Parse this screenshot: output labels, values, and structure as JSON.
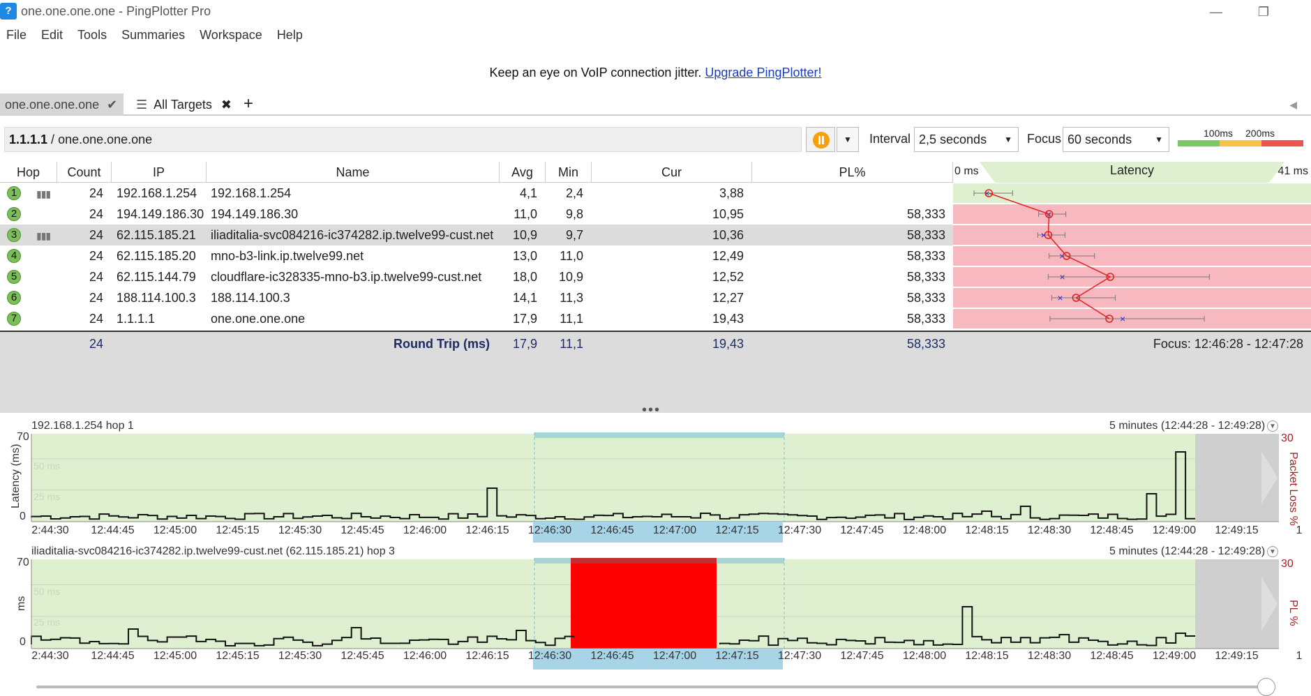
{
  "window": {
    "title": "one.one.one.one - PingPlotter Pro",
    "app_icon": "pingplotter-logo-icon",
    "minimize_icon": "—",
    "restore_icon": "❐"
  },
  "menu": [
    "File",
    "Edit",
    "Tools",
    "Summaries",
    "Workspace",
    "Help"
  ],
  "banner": {
    "text": "Keep an eye on VoIP connection jitter.",
    "link": "Upgrade PingPlotter!"
  },
  "tabs": {
    "active_label": "one.one.one.one",
    "all_targets_label": "All Targets",
    "add_label": "+"
  },
  "target": {
    "ip": "1.1.1.1",
    "separator": " / ",
    "host": "one.one.one.one"
  },
  "controls": {
    "interval_label": "Interval",
    "interval_value": "2,5 seconds",
    "focus_label": "Focus",
    "focus_value": "60 seconds",
    "scale_100": "100ms",
    "scale_200": "200ms"
  },
  "table": {
    "headers": [
      "Hop",
      "Count",
      "IP",
      "Name",
      "Avg",
      "Min",
      "Cur",
      "PL%"
    ],
    "latency_header": "Latency",
    "latency_min": "0 ms",
    "latency_max": "41 ms",
    "rows": [
      {
        "hop": "1",
        "count": "24",
        "ip": "192.168.1.254",
        "name": "192.168.1.254",
        "avg": "4,1",
        "min": "2,4",
        "cur": "3,88",
        "pl": ""
      },
      {
        "hop": "2",
        "count": "24",
        "ip": "194.149.186.30",
        "name": "194.149.186.30",
        "avg": "11,0",
        "min": "9,8",
        "cur": "10,95",
        "pl": "58,333"
      },
      {
        "hop": "3",
        "count": "24",
        "ip": "62.115.185.21",
        "name": "iliaditalia-svc084216-ic374282.ip.twelve99-cust.net",
        "avg": "10,9",
        "min": "9,7",
        "cur": "10,36",
        "pl": "58,333"
      },
      {
        "hop": "4",
        "count": "24",
        "ip": "62.115.185.20",
        "name": "mno-b3-link.ip.twelve99.net",
        "avg": "13,0",
        "min": "11,0",
        "cur": "12,49",
        "pl": "58,333"
      },
      {
        "hop": "5",
        "count": "24",
        "ip": "62.115.144.79",
        "name": "cloudflare-ic328335-mno-b3.ip.twelve99-cust.net",
        "avg": "18,0",
        "min": "10,9",
        "cur": "12,52",
        "pl": "58,333"
      },
      {
        "hop": "6",
        "count": "24",
        "ip": "188.114.100.3",
        "name": "188.114.100.3",
        "avg": "14,1",
        "min": "11,3",
        "cur": "12,27",
        "pl": "58,333"
      },
      {
        "hop": "7",
        "count": "24",
        "ip": "1.1.1.1",
        "name": "one.one.one.one",
        "avg": "17,9",
        "min": "11,1",
        "cur": "19,43",
        "pl": "58,333"
      }
    ],
    "summary": {
      "count": "24",
      "label": "Round Trip (ms)",
      "avg": "17,9",
      "min": "11,1",
      "cur": "19,43",
      "pl": "58,333",
      "focus": "Focus: 12:46:28 - 12:47:28"
    }
  },
  "graph1": {
    "title": "192.168.1.254 hop 1",
    "range": "5 minutes (12:44:28 - 12:49:28)",
    "y_label": "Latency (ms)",
    "y_top": "70",
    "y_zero": "0",
    "y_right_label": "Packet Loss %",
    "y_right_top": "30",
    "grid_50": "50 ms",
    "grid_25": "25 ms"
  },
  "graph2": {
    "title": "iliaditalia-svc084216-ic374282.ip.twelve99-cust.net (62.115.185.21) hop 3",
    "range": "5 minutes (12:44:28 - 12:49:28)",
    "y_label": "ms",
    "y_top": "70",
    "y_zero": "0",
    "y_right_label": "PL %",
    "y_right_top": "30",
    "grid_50": "50 ms",
    "grid_25": "25 ms"
  },
  "x_ticks": [
    "2:44:30",
    "12:44:45",
    "12:45:00",
    "12:45:15",
    "12:45:30",
    "12:45:45",
    "12:46:00",
    "12:46:15",
    "12:46:30",
    "12:46:45",
    "12:47:00",
    "12:47:15",
    "12:47:30",
    "12:47:45",
    "12:48:00",
    "12:48:15",
    "12:48:30",
    "12:48:45",
    "12:49:00",
    "12:49:15",
    "1"
  ],
  "colors": {
    "green_bg": "#dff0d0",
    "red_loss": "#ff0000",
    "pink_loss": "#f8b8c0",
    "focus_blue": "#a8d4e8",
    "hop_green": "#7cbf5a"
  }
}
